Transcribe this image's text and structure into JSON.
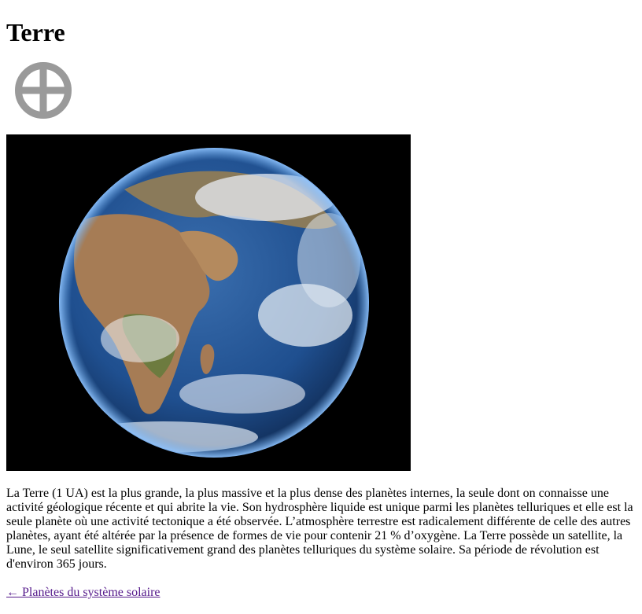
{
  "page": {
    "title": "Terre",
    "symbol_icon": "earth-symbol-icon",
    "photo_icon": "earth-globe-photo",
    "description": "La Terre (1 UA) est la plus grande, la plus massive et la plus dense des planètes internes, la seule dont on connaisse une activité géologique récente et qui abrite la vie. Son hydrosphère liquide est unique parmi les planètes telluriques et elle est la seule planète où une activité tectonique a été observée. L’atmosphère terrestre est radicalement différente de celle des autres planètes, ayant été altérée par la présence de formes de vie pour contenir 21 % d’oxygène. La Terre possède un satellite, la Lune, le seul satellite significativement grand des planètes telluriques du système solaire. Sa période de révolution est d'environ 365 jours.",
    "back_link": "← Planètes du système solaire"
  },
  "colors": {
    "symbol_gray": "#9a9a9a",
    "link_visited": "#551a8b",
    "photo_background": "#000000",
    "ocean": "#1f4f8f",
    "land": "#a67c55"
  }
}
